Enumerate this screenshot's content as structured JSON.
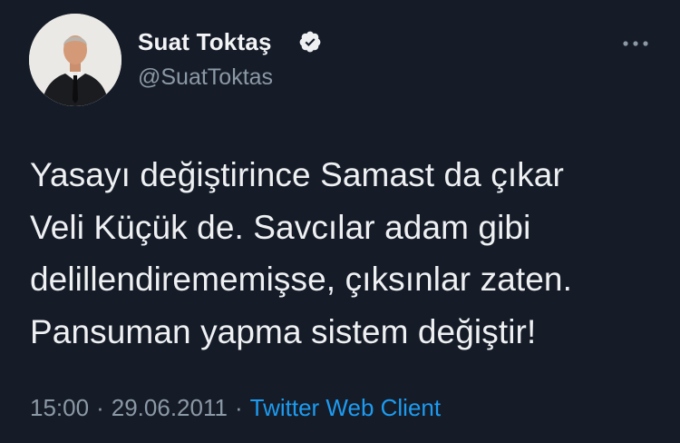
{
  "author": {
    "display_name": "Suat Toktaş",
    "handle": "@SuatToktas",
    "verified": true
  },
  "tweet": {
    "lines": [
      "Yasayı değiştirince Samast da çıkar",
      "Veli Küçük de. Savcılar adam gibi",
      "delillendirememişse, çıksınlar zaten.",
      "Pansuman yapma sistem değiştir!"
    ]
  },
  "meta": {
    "time": "15:00",
    "separator": "·",
    "date": "29.06.2011",
    "source": "Twitter Web Client"
  },
  "icons": {
    "verified": "verified-badge-icon",
    "more": "more-horizontal-icon"
  },
  "colors": {
    "background": "#151c28",
    "text": "#eef0f2",
    "secondary": "#8b98a5",
    "link": "#1d9bf0"
  }
}
